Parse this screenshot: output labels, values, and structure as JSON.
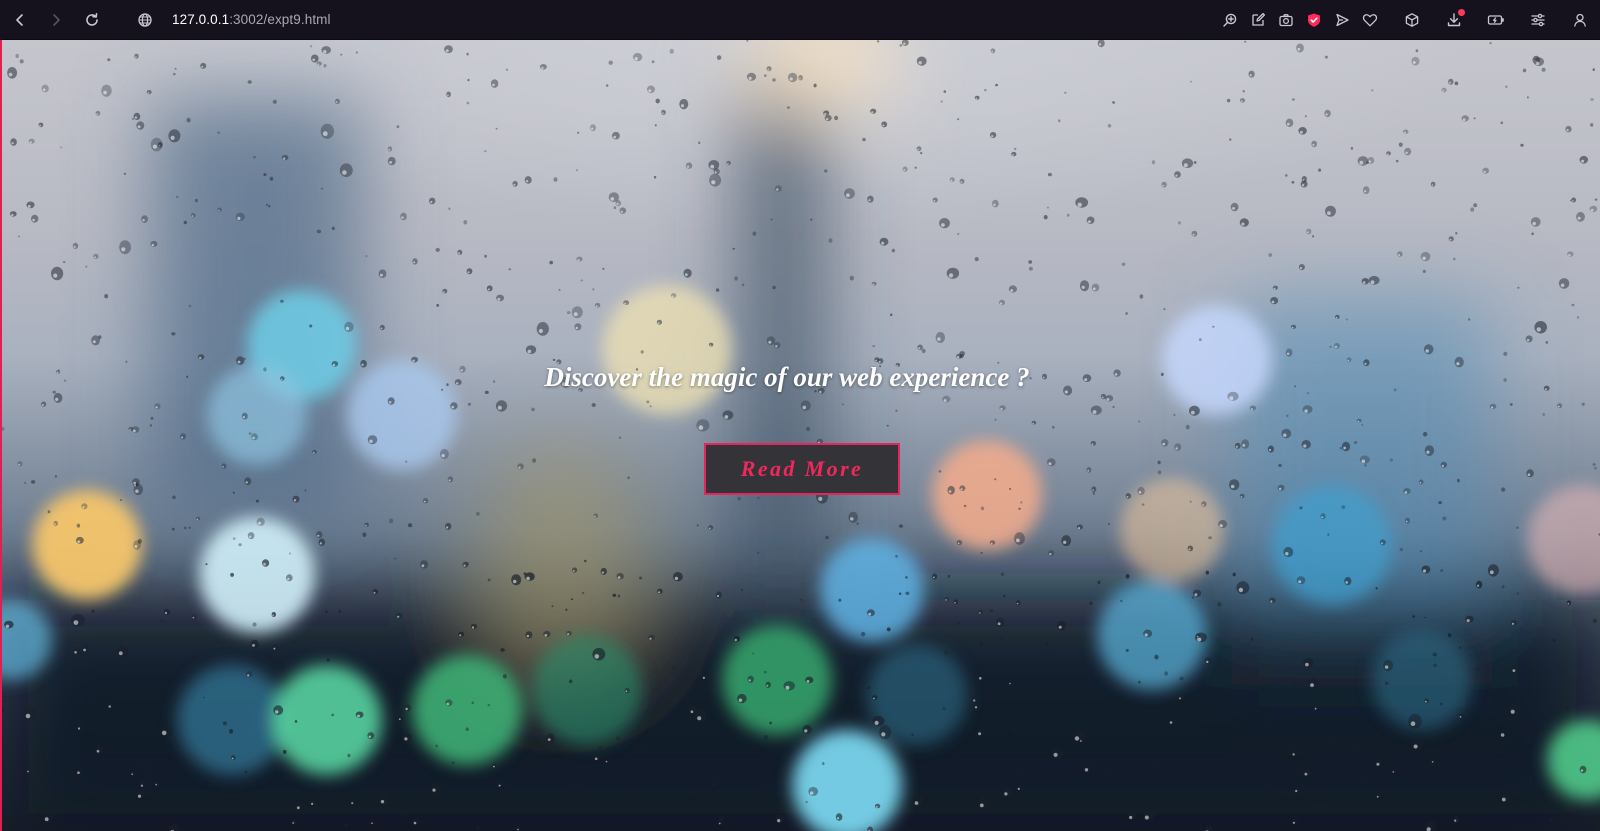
{
  "browser": {
    "url_host": "127.0.0.1",
    "url_rest": ":3002/expt9.html",
    "icons": {
      "back": "back-arrow-icon",
      "forward": "forward-arrow-icon",
      "reload": "reload-icon",
      "site_info": "globe-icon",
      "zoom": "zoom-icon",
      "edit": "edit-icon",
      "screenshot": "camera-icon",
      "shield": "shield-icon",
      "send": "send-icon",
      "favorite": "heart-icon",
      "extensions": "cube-icon",
      "downloads": "download-icon",
      "battery": "battery-icon",
      "settings": "settings-sliders-icon",
      "profile": "profile-icon"
    },
    "colors": {
      "accent": "#e0204f",
      "chrome_bg": "#15121d"
    }
  },
  "hero": {
    "headline": "Discover the magic of our web experience ?",
    "button_label": "Read More",
    "colors": {
      "button_bg": "#333338",
      "button_border": "#e8245a",
      "button_text": "#f0285e",
      "headline": "#ffffff"
    }
  }
}
